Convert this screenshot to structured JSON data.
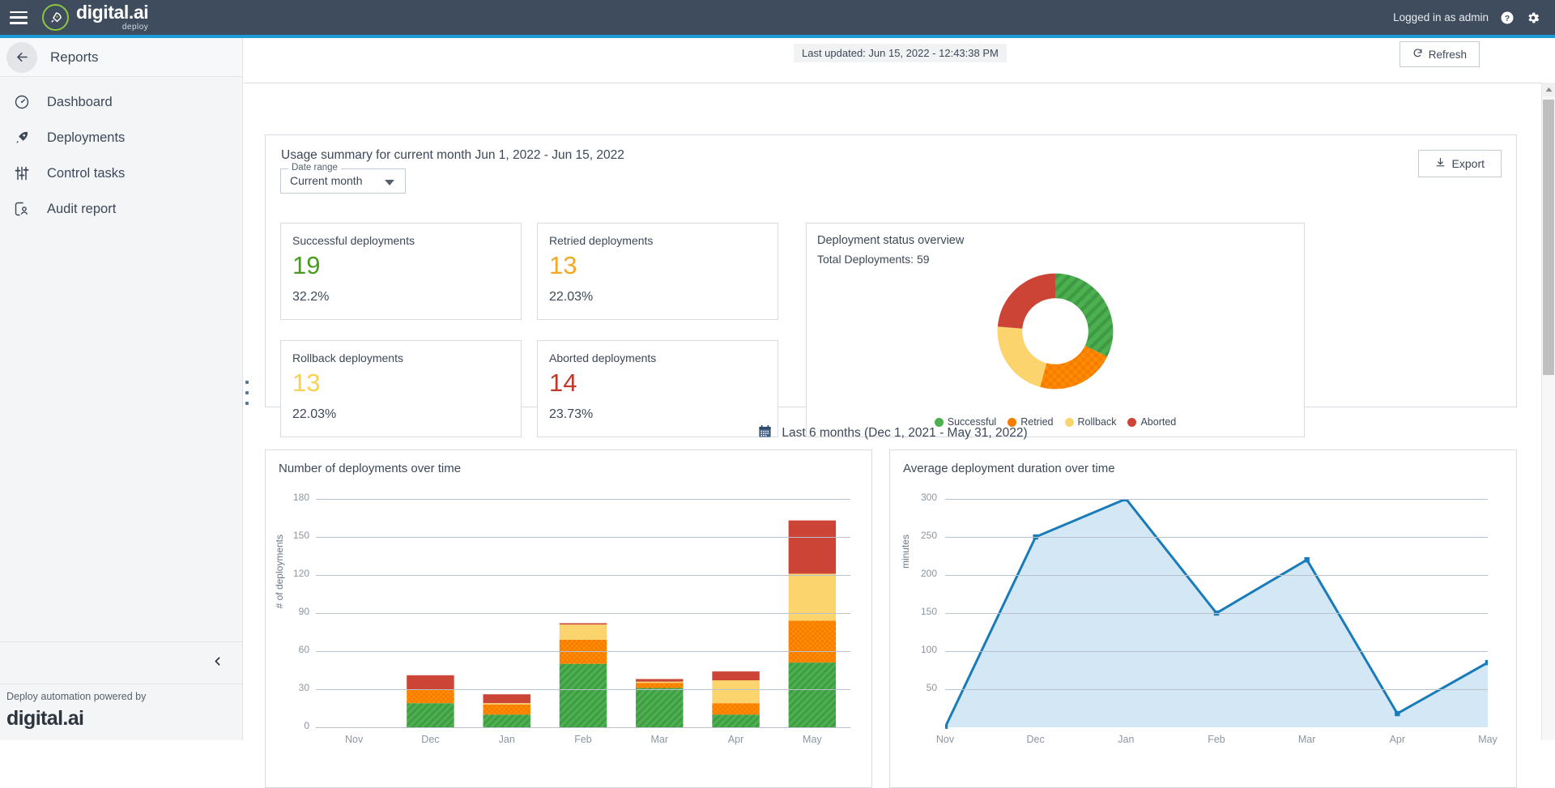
{
  "topbar": {
    "brand_name": "digital.ai",
    "brand_sub": "deploy",
    "logged_in": "Logged in as admin",
    "menu_icon": "hamburger-icon",
    "help_icon": "help-icon",
    "settings_icon": "gear-icon",
    "accent_color": "#1e9bd7",
    "bg_color": "#3e4c5e"
  },
  "sidebar": {
    "header_title": "Reports",
    "back_icon": "arrow-left-icon",
    "items": [
      {
        "label": "Dashboard",
        "icon": "speedometer-icon"
      },
      {
        "label": "Deployments",
        "icon": "rocket-icon"
      },
      {
        "label": "Control tasks",
        "icon": "sliders-icon"
      },
      {
        "label": "Audit report",
        "icon": "audit-user-icon"
      }
    ],
    "collapse_icon": "chevron-left-icon",
    "footer_text": "Deploy automation powered by",
    "footer_logo": "digital.ai"
  },
  "main_top": {
    "last_updated": "Last updated: Jun 15, 2022 - 12:43:38 PM",
    "refresh_label": "Refresh",
    "refresh_icon": "refresh-icon"
  },
  "usage": {
    "title": "Usage summary for current month Jun 1, 2022 - Jun 15, 2022",
    "date_range_legend": "Date range",
    "date_range_value": "Current month",
    "date_range_options": [
      "Current month"
    ],
    "export_label": "Export",
    "export_icon": "download-icon",
    "cards": [
      {
        "label": "Successful deployments",
        "value": "19",
        "pct": "32.2%",
        "color": "#4a9c1f"
      },
      {
        "label": "Retried deployments",
        "value": "13",
        "pct": "22.03%",
        "color": "#f5a623"
      },
      {
        "label": "Rollback deployments",
        "value": "13",
        "pct": "22.03%",
        "color": "#f7d154"
      },
      {
        "label": "Aborted deployments",
        "value": "14",
        "pct": "23.73%",
        "color": "#c0392b"
      }
    ]
  },
  "six_month": {
    "calendar_icon": "calendar-icon",
    "label": "Last 6 months (Dec 1, 2021 - May 31, 2022)"
  },
  "colors": {
    "successful": "#4caf50",
    "retried": "#f57c00",
    "rollback": "#fbd46d",
    "aborted": "#cc4436",
    "line": "#1a7bb9",
    "area_fill": "#d3e7f5"
  },
  "chart_data": [
    {
      "type": "pie",
      "title": "Deployment status overview",
      "subtitle": "Total Deployments: 59",
      "legend_position": "bottom",
      "labels": [
        "Successful",
        "Retried",
        "Rollback",
        "Aborted"
      ],
      "values": [
        19,
        13,
        13,
        14
      ],
      "percentages": [
        32.2,
        22.03,
        22.03,
        23.73
      ],
      "colors": [
        "#4caf50",
        "#f57c00",
        "#fbd46d",
        "#cc4436"
      ]
    },
    {
      "type": "bar",
      "title": "Number of deployments over time",
      "xlabel": "",
      "ylabel": "# of deployments",
      "ylim": [
        0,
        180
      ],
      "yticks": [
        0,
        30,
        60,
        90,
        120,
        150,
        180
      ],
      "grid": true,
      "stacked": true,
      "categories": [
        "Nov",
        "Dec",
        "Jan",
        "Feb",
        "Mar",
        "Apr",
        "May"
      ],
      "series": [
        {
          "name": "Successful",
          "values": [
            0,
            19,
            10,
            50,
            31,
            10,
            51
          ]
        },
        {
          "name": "Retried",
          "values": [
            0,
            11,
            8,
            19,
            4,
            9,
            33
          ]
        },
        {
          "name": "Rollback",
          "values": [
            0,
            0,
            1,
            12,
            1,
            18,
            37
          ]
        },
        {
          "name": "Aborted",
          "values": [
            0,
            11,
            7,
            1,
            2,
            7,
            42
          ]
        }
      ]
    },
    {
      "type": "area",
      "title": "Average deployment duration over time",
      "xlabel": "",
      "ylabel": "minutes",
      "ylim": [
        0,
        300
      ],
      "yticks": [
        50,
        100,
        150,
        200,
        250,
        300
      ],
      "grid": true,
      "categories": [
        "Nov",
        "Dec",
        "Jan",
        "Feb",
        "Mar",
        "Apr",
        "May"
      ],
      "values": [
        0,
        250,
        300,
        150,
        220,
        18,
        85
      ]
    }
  ]
}
